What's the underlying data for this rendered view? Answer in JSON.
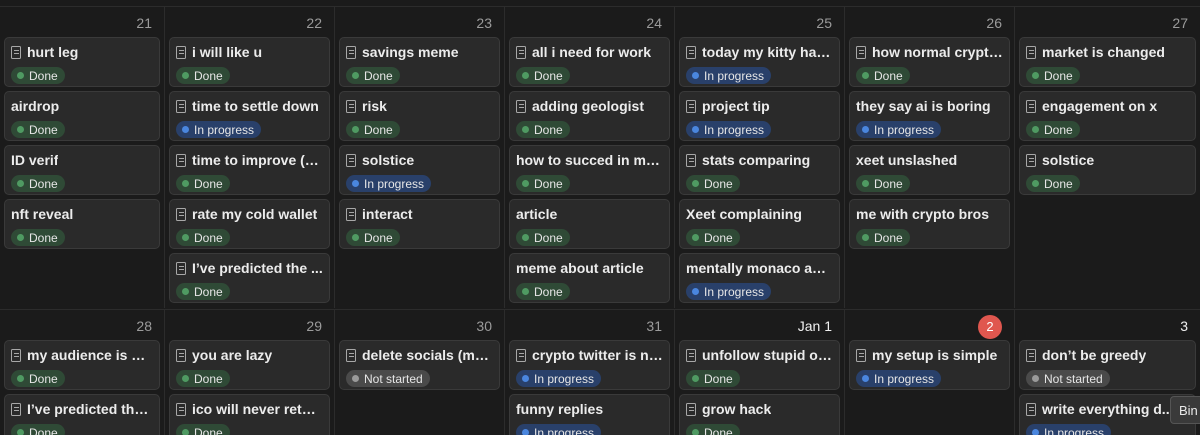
{
  "weeks": [
    {
      "days": [
        {
          "label": "21",
          "cards": [
            {
              "title": "hurt leg",
              "status": "Done",
              "icon": true
            },
            {
              "title": "airdrop",
              "status": "Done",
              "icon": false
            },
            {
              "title": "ID verif",
              "status": "Done",
              "icon": false
            },
            {
              "title": "nft reveal",
              "status": "Done",
              "icon": false
            }
          ]
        },
        {
          "label": "22",
          "cards": [
            {
              "title": "i will like u",
              "status": "Done",
              "icon": true
            },
            {
              "title": "time to settle down",
              "status": "In progress",
              "icon": true
            },
            {
              "title": "time to improve (m...",
              "status": "Done",
              "icon": true
            },
            {
              "title": "rate my cold wallet",
              "status": "Done",
              "icon": true
            },
            {
              "title": "I’ve predicted the ...",
              "status": "Done",
              "icon": true
            }
          ]
        },
        {
          "label": "23",
          "cards": [
            {
              "title": "savings meme",
              "status": "Done",
              "icon": true
            },
            {
              "title": "risk",
              "status": "Done",
              "icon": true
            },
            {
              "title": "solstice",
              "status": "In progress",
              "icon": true
            },
            {
              "title": "interact",
              "status": "Done",
              "icon": true
            }
          ]
        },
        {
          "label": "24",
          "cards": [
            {
              "title": "all i need for work",
              "status": "Done",
              "icon": true
            },
            {
              "title": "adding geologist",
              "status": "Done",
              "icon": true
            },
            {
              "title": "how to succed in mar...",
              "status": "Done",
              "icon": false
            },
            {
              "title": "article",
              "status": "Done",
              "icon": false
            },
            {
              "title": "meme about article",
              "status": "Done",
              "icon": false
            }
          ]
        },
        {
          "label": "25",
          "cards": [
            {
              "title": "today my kitty has ...",
              "status": "In progress",
              "icon": true
            },
            {
              "title": "project tip",
              "status": "In progress",
              "icon": true
            },
            {
              "title": "stats comparing",
              "status": "Done",
              "icon": true
            },
            {
              "title": "Xeet complaining",
              "status": "Done",
              "icon": false
            },
            {
              "title": "mentally monaco again",
              "status": "In progress",
              "icon": false
            }
          ]
        },
        {
          "label": "26",
          "cards": [
            {
              "title": "how normal crypto...",
              "status": "Done",
              "icon": true
            },
            {
              "title": "they say ai is boring",
              "status": "In progress",
              "icon": false
            },
            {
              "title": "xeet unslashed",
              "status": "Done",
              "icon": false
            },
            {
              "title": "me with crypto bros",
              "status": "Done",
              "icon": false
            }
          ]
        },
        {
          "label": "27",
          "cards": [
            {
              "title": "market is changed",
              "status": "Done",
              "icon": true
            },
            {
              "title": "engagement on x",
              "status": "Done",
              "icon": true
            },
            {
              "title": "solstice",
              "status": "Done",
              "icon": true
            }
          ]
        }
      ]
    },
    {
      "days": [
        {
          "label": "28",
          "cards": [
            {
              "title": "my audience is a m...",
              "status": "Done",
              "icon": true
            },
            {
              "title": "I’ve predicted the ...",
              "status": "Done",
              "icon": true
            }
          ]
        },
        {
          "label": "29",
          "cards": [
            {
              "title": "you are lazy",
              "status": "Done",
              "icon": true
            },
            {
              "title": "ico will never return",
              "status": "Done",
              "icon": true
            }
          ]
        },
        {
          "label": "30",
          "cards": [
            {
              "title": "delete socials (ma...",
              "status": "Not started",
              "icon": true
            }
          ]
        },
        {
          "label": "31",
          "cards": [
            {
              "title": "crypto twitter is no...",
              "status": "In progress",
              "icon": true
            },
            {
              "title": "funny replies",
              "status": "In progress",
              "icon": false
            }
          ]
        },
        {
          "label": "Jan 1",
          "cards": [
            {
              "title": "unfollow stupid ones",
              "status": "Done",
              "icon": true
            },
            {
              "title": "grow hack",
              "status": "Done",
              "icon": true
            }
          ]
        },
        {
          "label": "2",
          "today": true,
          "cards": [
            {
              "title": "my setup is simple",
              "status": "In progress",
              "icon": true
            }
          ]
        },
        {
          "label": "3",
          "cards": [
            {
              "title": "don’t be greedy",
              "status": "Not started",
              "icon": true
            },
            {
              "title": "write everything d...",
              "status": "In progress",
              "icon": true
            }
          ]
        }
      ]
    }
  ],
  "tooltip": "Bin",
  "colors": {
    "done": "#4f9a62",
    "in_progress": "#4a86de",
    "not_started": "#9a9a9a",
    "today": "#e0574f"
  }
}
